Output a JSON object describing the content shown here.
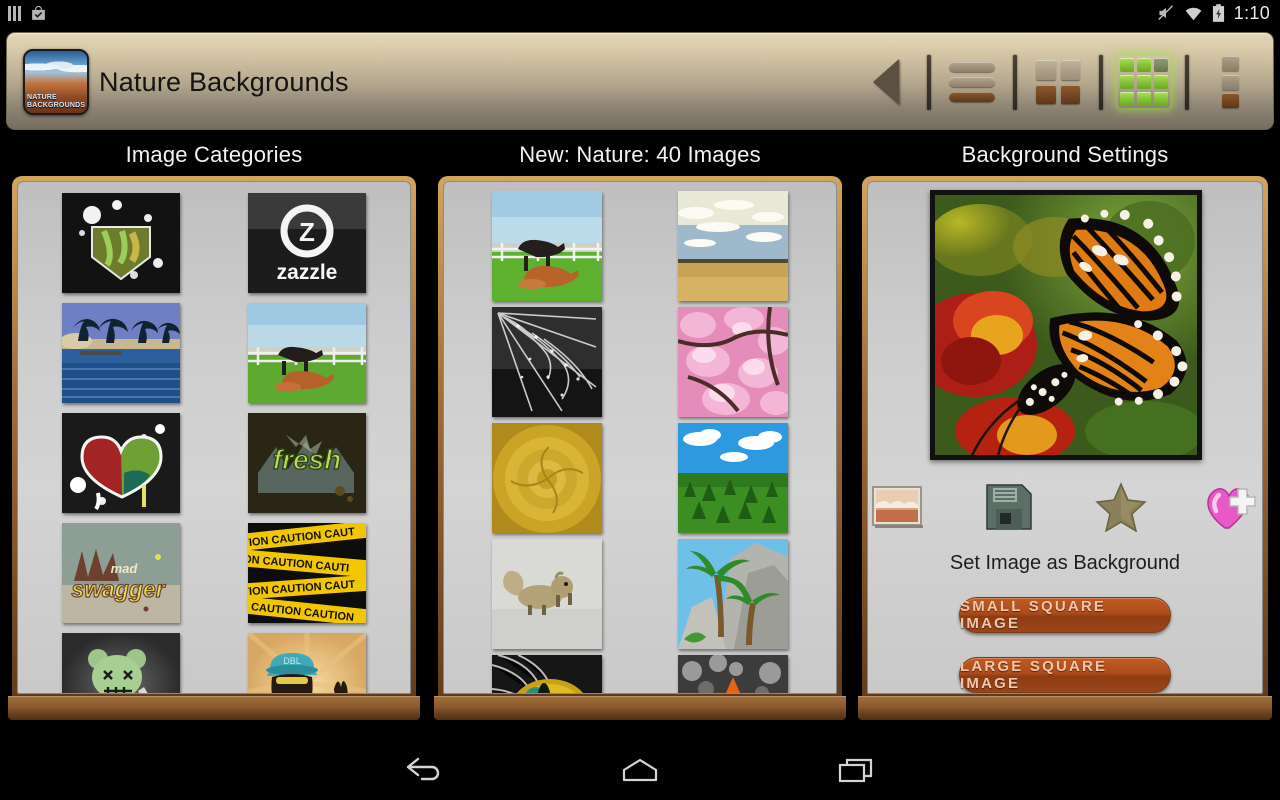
{
  "statusbar": {
    "left_icons": [
      {
        "name": "signal-bars-icon",
        "glyph": "bars"
      },
      {
        "name": "play-store-bag-icon",
        "glyph": "bag-check"
      }
    ],
    "right_icons": [
      {
        "name": "mute-icon",
        "glyph": "speaker-muted"
      },
      {
        "name": "wifi-icon",
        "glyph": "wifi"
      },
      {
        "name": "battery-charging-icon",
        "glyph": "battery-bolt"
      }
    ],
    "time": "1:10"
  },
  "actionbar": {
    "app_icon_name": "app-icon",
    "app_icon_caption": "NATURE BACKGROUNDS",
    "title": "Nature Backgrounds",
    "tools": [
      {
        "name": "back-arrow-icon",
        "label": "Back"
      },
      {
        "name": "list-view-icon",
        "label": "List view"
      },
      {
        "name": "grid-2x2-view-icon",
        "label": "Grid 2x2 view"
      },
      {
        "name": "grid-3x3-view-icon",
        "label": "Grid 3x3 view",
        "active": true
      },
      {
        "name": "overflow-menu-icon",
        "label": "More options"
      }
    ]
  },
  "columns": {
    "left": {
      "header": "Image Categories",
      "thumbs": [
        {
          "name": "thumb-jk-arrow-graffiti"
        },
        {
          "name": "thumb-zazzle-logo"
        },
        {
          "name": "thumb-palm-lagoon"
        },
        {
          "name": "thumb-horses-pasture"
        },
        {
          "name": "thumb-graffiti-heart"
        },
        {
          "name": "thumb-fresh-graffiti"
        },
        {
          "name": "thumb-mad-swagger"
        },
        {
          "name": "thumb-caution-tape"
        },
        {
          "name": "thumb-zombie-bear"
        },
        {
          "name": "thumb-hipster-beard"
        }
      ]
    },
    "middle": {
      "header": "New: Nature: 40 Images",
      "thumbs": [
        {
          "name": "thumb-horses-pasture"
        },
        {
          "name": "thumb-golden-field-sky"
        },
        {
          "name": "thumb-dewy-spiderweb"
        },
        {
          "name": "thumb-pink-blossoms"
        },
        {
          "name": "thumb-yellow-rose"
        },
        {
          "name": "thumb-forest-blue-sky"
        },
        {
          "name": "thumb-squirrel-sand"
        },
        {
          "name": "thumb-palms-rocks"
        },
        {
          "name": "thumb-cat-eye"
        },
        {
          "name": "thumb-orange-starfish"
        }
      ]
    },
    "right": {
      "header": "Background Settings",
      "preview_name": "preview-monarch-butterfly",
      "action_icons": [
        {
          "name": "set-wallpaper-icon",
          "label": "Set as wallpaper"
        },
        {
          "name": "save-floppy-icon",
          "label": "Save image"
        },
        {
          "name": "favorite-star-icon",
          "label": "Favorite"
        },
        {
          "name": "add-to-favorites-heart-icon",
          "label": "Add to favorites"
        }
      ],
      "set_bg_label": "Set Image as Background",
      "small_button": "SMALL SQUARE IMAGE",
      "large_button": "LARGE SQUARE IMAGE"
    }
  },
  "navbar": {
    "back": "back-nav-icon",
    "home": "home-nav-icon",
    "recent": "recent-apps-nav-icon"
  },
  "colors": {
    "actionbar_top": "#e4d7b9",
    "actionbar_bottom": "#776e60",
    "panel_frame": "#a06e38",
    "panel_interior": "#cdcdcd",
    "button_orange": "#ad4c1c",
    "active_grid_green": "#8fd23c",
    "status_text": "#e9e9e9"
  }
}
